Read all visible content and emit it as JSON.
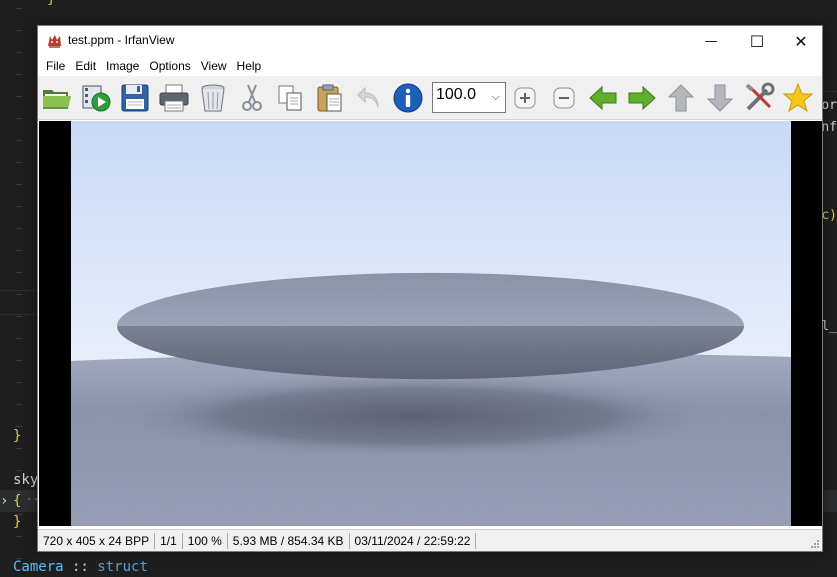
{
  "editor": {
    "top_brace": "}",
    "brace_close_1": "}",
    "sky_text": "sky",
    "brace_open": "{",
    "fold_ellipsis": "···",
    "brace_close_2": "}",
    "camera_line": {
      "name": "Camera",
      "sep": " :: ",
      "keyword": "struct"
    },
    "side_fragments": [
      "or",
      "nf",
      "c)",
      "l_"
    ]
  },
  "window": {
    "title": "test.ppm - IrfanView",
    "controls": {
      "minimize": "—",
      "maximize": "☐",
      "close": "✕"
    }
  },
  "menu": [
    "File",
    "Edit",
    "Image",
    "Options",
    "View",
    "Help"
  ],
  "toolbar": {
    "zoom_value": "100.0",
    "buttons": [
      "open-folder-icon",
      "slideshow-icon",
      "save-icon",
      "print-icon",
      "delete-icon",
      "cut-icon",
      "copy-icon",
      "paste-icon",
      "undo-icon",
      "info-icon",
      "zoom-in-icon",
      "zoom-out-icon",
      "previous-icon",
      "next-icon",
      "up-icon",
      "down-icon",
      "settings-icon",
      "favorite-icon"
    ]
  },
  "status": {
    "dimensions": "720 x 405 x 24 BPP",
    "page": "1/1",
    "zoom": "100 %",
    "size": "5.93 MB / 854.34 KB",
    "datetime": "03/11/2024 / 22:59:22"
  },
  "colors": {
    "sky_top": "#c9d9f5",
    "sky_bottom": "#e7eef9",
    "ground": "#8e99b3",
    "disc_top": "#8f98ad",
    "disc_bottom": "#555f73"
  }
}
